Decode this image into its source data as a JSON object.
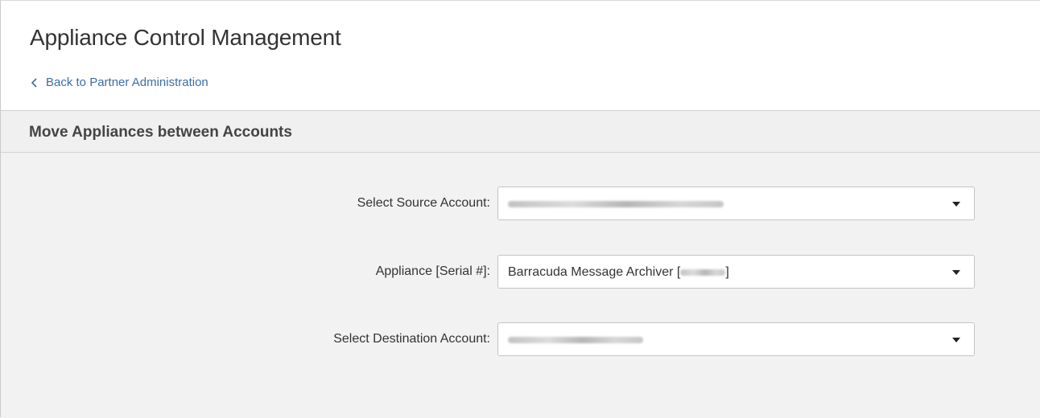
{
  "header": {
    "title": "Appliance Control Management",
    "back_link": "Back to Partner Administration"
  },
  "section": {
    "title": "Move Appliances between Accounts"
  },
  "form": {
    "source_account": {
      "label": "Select Source Account:",
      "value_redacted": true
    },
    "appliance": {
      "label": "Appliance [Serial #]:",
      "value_prefix": "Barracuda Message Archiver [",
      "value_suffix": "]"
    },
    "destination_account": {
      "label": "Select Destination Account:",
      "value_redacted": true
    }
  },
  "icons": {
    "back": "chevron-left-icon",
    "dropdown": "caret-down-icon"
  },
  "colors": {
    "link": "#3a6ea5",
    "section_bg": "#f0f0f0",
    "content_bg": "#f2f2f2"
  }
}
